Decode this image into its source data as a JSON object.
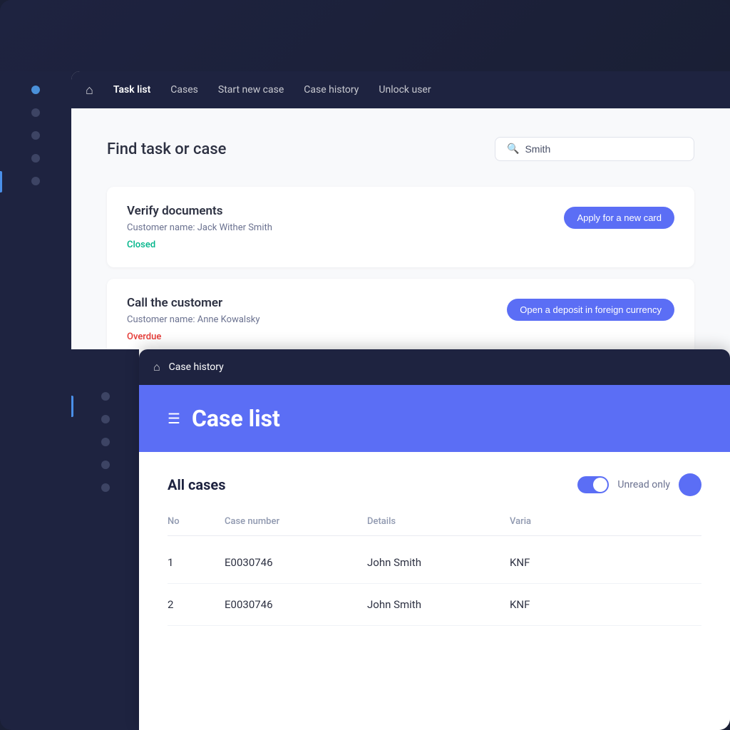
{
  "app": {
    "bg_color": "#1a1f35"
  },
  "top_nav": {
    "home_icon": "⌂",
    "links": [
      {
        "label": "Task list",
        "active": true
      },
      {
        "label": "Cases",
        "active": false
      },
      {
        "label": "Start new case",
        "active": false
      },
      {
        "label": "Case history",
        "active": false
      },
      {
        "label": "Unlock user",
        "active": false
      }
    ]
  },
  "task_list": {
    "find_title": "Find task or case",
    "search_placeholder": "Smith",
    "search_value": "Smith",
    "tasks": [
      {
        "title": "Verify documents",
        "customer": "Customer name: Jack Wither Smith",
        "status": "Closed",
        "status_type": "closed",
        "tag": "Apply for a new card"
      },
      {
        "title": "Call the customer",
        "customer": "Customer name: Anne Kowalsky",
        "status": "Overdue",
        "status_type": "overdue",
        "tag": "Open a deposit in foreign currency"
      }
    ]
  },
  "case_history_window": {
    "nav_home_icon": "⌂",
    "nav_title": "Case history",
    "header_menu_icon": "☰",
    "header_title": "Case list",
    "all_cases_label": "All cases",
    "unread_only_label": "Unread only",
    "table": {
      "columns": [
        "No",
        "Case number",
        "Details",
        "Varia"
      ],
      "rows": [
        {
          "no": "1",
          "case_number": "E0030746",
          "details": "John Smith",
          "variant": "KNF"
        },
        {
          "no": "2",
          "case_number": "E0030746",
          "details": "John Smith",
          "variant": "KNF"
        }
      ]
    }
  },
  "sidebar": {
    "dots": [
      {
        "active": true
      },
      {
        "active": false
      },
      {
        "active": false
      },
      {
        "active": false
      },
      {
        "active": false
      }
    ]
  },
  "second_sidebar": {
    "dots": [
      {
        "active": true
      },
      {
        "active": false
      },
      {
        "active": false
      },
      {
        "active": false
      },
      {
        "active": false
      }
    ]
  }
}
